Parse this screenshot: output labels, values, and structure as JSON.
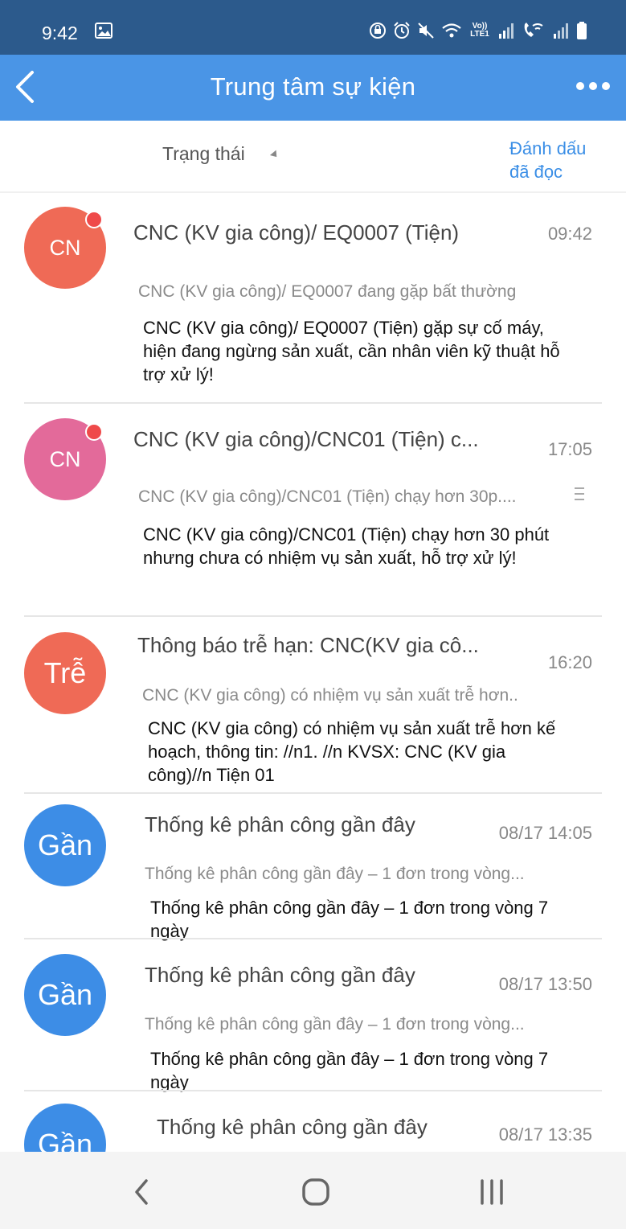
{
  "status_bar": {
    "time": "9:42",
    "lte_label": "Vo)) LTE1",
    "icons": [
      "gallery-icon",
      "lock-rotate-icon",
      "alarm-icon",
      "mute-icon",
      "wifi-icon",
      "signal-icon",
      "wifi-call-icon",
      "battery-icon"
    ]
  },
  "app_bar": {
    "title": "Trung tâm sự kiện",
    "color": "#4a95e6"
  },
  "filter_bar": {
    "status_filter_label": "Trạng thái",
    "mark_read_line1": "Đánh dấu",
    "mark_read_line2": "đã đọc"
  },
  "events": [
    {
      "avatar_text": "CN",
      "avatar_color": "#ef6a56",
      "unread": true,
      "title": "CNC (KV gia công)/ EQ0007 (Tiện)",
      "time": "09:42",
      "subtitle": "CNC (KV gia công)/ EQ0007 đang gặp bất thường",
      "body": "CNC (KV gia công)/ EQ0007 (Tiện) gặp sự cố máy, hiện đang ngừng sản xuất, cần nhân viên kỹ thuật hỗ trợ xử lý!"
    },
    {
      "avatar_text": "CN",
      "avatar_color": "#e36a9a",
      "unread": true,
      "title": "CNC (KV gia công)/CNC01 (Tiện) c...",
      "time": "17:05",
      "subtitle": "CNC (KV gia công)/CNC01 (Tiện) chạy hơn 30p....",
      "body": "CNC (KV gia công)/CNC01 (Tiện)  chạy hơn 30 phút nhưng chưa có nhiệm vụ sản xuất, hỗ trợ xử lý!"
    },
    {
      "avatar_text": "Trễ",
      "avatar_color": "#ef6a56",
      "unread": false,
      "title": "Thông báo trễ hạn: CNC(KV gia cô...",
      "time": "16:20",
      "subtitle": "CNC (KV gia công) có nhiệm vụ sản xuất trễ hơn..",
      "body": "CNC (KV gia công) có nhiệm vụ sản xuất trễ hơn kế hoạch, thông tin: //n1. //n KVSX: CNC (KV gia công)//n Tiện 01"
    },
    {
      "avatar_text": "Gần",
      "avatar_color": "#3d8de6",
      "unread": false,
      "title": "Thống kê phân công gần đây",
      "time": "08/17 14:05",
      "subtitle": "Thống kê phân công gần đây – 1 đơn trong vòng...",
      "body": "Thống kê phân công gần đây – 1 đơn trong vòng 7 ngày"
    },
    {
      "avatar_text": "Gần",
      "avatar_color": "#3d8de6",
      "unread": false,
      "title": "Thống kê phân công gần đây",
      "time": "08/17 13:50",
      "subtitle": "Thống kê phân công gần đây – 1 đơn trong vòng...",
      "body": "Thống kê phân công gần đây – 1 đơn trong vòng 7 ngày"
    },
    {
      "avatar_text": "Gần",
      "avatar_color": "#3d8de6",
      "unread": false,
      "title": "Thống kê phân công gần đây",
      "time": "08/17 13:35",
      "subtitle": "",
      "body": ""
    }
  ],
  "nav_bar": {
    "icons": [
      "back-nav-icon",
      "home-nav-icon",
      "recents-nav-icon"
    ]
  }
}
